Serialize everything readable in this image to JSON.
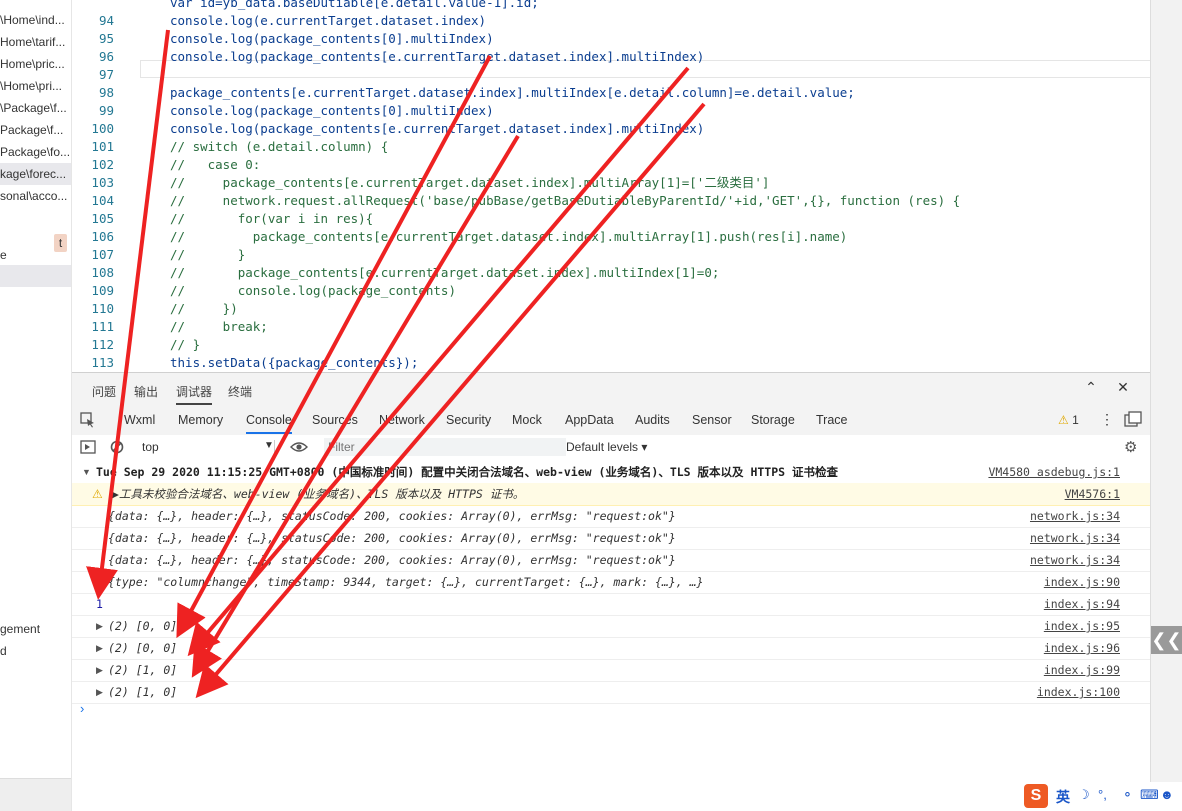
{
  "sidebar": {
    "items": [
      "\\Home\\ind...",
      "Home\\tarif...",
      "Home\\pric...",
      "\\Home\\pri...",
      "\\Package\\f...",
      "Package\\f...",
      "Package\\fo...",
      "kage\\forec...",
      "sonal\\acco..."
    ],
    "label_e": "e",
    "badge": "t",
    "label_agement": "gement",
    "label_d": "d"
  },
  "editor": {
    "lines": [
      {
        "num": "",
        "text": "var id=yb_data.baseDutiable[e.detail.value-1].id;",
        "comment": false
      },
      {
        "num": "94",
        "text": "console.log(e.currentTarget.dataset.index)",
        "comment": false
      },
      {
        "num": "95",
        "text": "console.log(package_contents[0].multiIndex)",
        "comment": false
      },
      {
        "num": "96",
        "text": "console.log(package_contents[e.currentTarget.dataset.index].multiIndex)",
        "comment": false
      },
      {
        "num": "97",
        "text": "",
        "comment": false
      },
      {
        "num": "98",
        "text": "package_contents[e.currentTarget.dataset.index].multiIndex[e.detail.column]=e.detail.value;",
        "comment": false
      },
      {
        "num": "99",
        "text": "console.log(package_contents[0].multiIndex)",
        "comment": false
      },
      {
        "num": "100",
        "text": "console.log(package_contents[e.currentTarget.dataset.index].multiIndex)",
        "comment": false
      },
      {
        "num": "101",
        "text": "// switch (e.detail.column) {",
        "comment": true
      },
      {
        "num": "102",
        "text": "//   case 0:",
        "comment": true
      },
      {
        "num": "103",
        "text": "//     package_contents[e.currentTarget.dataset.index].multiArray[1]=['二级类目']",
        "comment": true
      },
      {
        "num": "104",
        "text": "//     network.request.allRequest('base/pubBase/getBaseDutiableByParentId/'+id,'GET',{}, function (res) {",
        "comment": true
      },
      {
        "num": "105",
        "text": "//       for(var i in res){",
        "comment": true
      },
      {
        "num": "106",
        "text": "//         package_contents[e.currentTarget.dataset.index].multiArray[1].push(res[i].name)",
        "comment": true
      },
      {
        "num": "107",
        "text": "//       }",
        "comment": true
      },
      {
        "num": "108",
        "text": "//       package_contents[e.currentTarget.dataset.index].multiIndex[1]=0;",
        "comment": true
      },
      {
        "num": "109",
        "text": "//       console.log(package_contents)",
        "comment": true
      },
      {
        "num": "110",
        "text": "//     })",
        "comment": true
      },
      {
        "num": "111",
        "text": "//     break;",
        "comment": true
      },
      {
        "num": "112",
        "text": "// }",
        "comment": true
      },
      {
        "num": "113",
        "text": "this.setData({package_contents});",
        "comment": false
      }
    ]
  },
  "devtools": {
    "top_tabs": [
      "问题",
      "输出",
      "调试器",
      "终端"
    ],
    "active_top_tab": "调试器",
    "panel_tabs": [
      "Wxml",
      "Memory",
      "Console",
      "Sources",
      "Network",
      "Security",
      "Mock",
      "AppData",
      "Audits",
      "Sensor",
      "Storage",
      "Trace"
    ],
    "active_panel_tab": "Console",
    "warning_count": "1",
    "context": "top",
    "filter_placeholder": "Filter",
    "levels": "Default levels",
    "rows": [
      {
        "kind": "group",
        "text": "Tue Sep 29 2020 11:15:25 GMT+0800 (中国标准时间) 配置中关闭合法域名、web-view (业务域名)、TLS 版本以及 HTTPS 证书检查",
        "src": "VM4580 asdebug.js:1"
      },
      {
        "kind": "warn",
        "text": "▶工具未校验合法域名、web-view (业务域名)、TLS 版本以及 HTTPS 证书。",
        "src": "VM4576:1"
      },
      {
        "kind": "obj",
        "text": "{data: {…}, header: {…}, statusCode: 200, cookies: Array(0), errMsg: \"request:ok\"}",
        "src": "network.js:34"
      },
      {
        "kind": "obj",
        "text": "{data: {…}, header: {…}, statusCode: 200, cookies: Array(0), errMsg: \"request:ok\"}",
        "src": "network.js:34"
      },
      {
        "kind": "obj",
        "text": "{data: {…}, header: {…}, statusCode: 200, cookies: Array(0), errMsg: \"request:ok\"}",
        "src": "network.js:34"
      },
      {
        "kind": "obj",
        "text": "{type: \"columnchange\", timeStamp: 9344, target: {…}, currentTarget: {…}, mark: {…}, …}",
        "src": "index.js:90"
      },
      {
        "kind": "num",
        "text": "1",
        "src": "index.js:94"
      },
      {
        "kind": "arr",
        "text": "(2) [0, 0]",
        "src": "index.js:95"
      },
      {
        "kind": "arr",
        "text": "(2) [0, 0]",
        "src": "index.js:96"
      },
      {
        "kind": "arr",
        "text": "(2) [1, 0]",
        "src": "index.js:99"
      },
      {
        "kind": "arr",
        "text": "(2) [1, 0]",
        "src": "index.js:100"
      }
    ],
    "prompt": "›"
  },
  "ime": {
    "logo": "S",
    "lang": "英"
  },
  "colors": {
    "arrow": "#ee2222",
    "link": "#1a73e8"
  }
}
